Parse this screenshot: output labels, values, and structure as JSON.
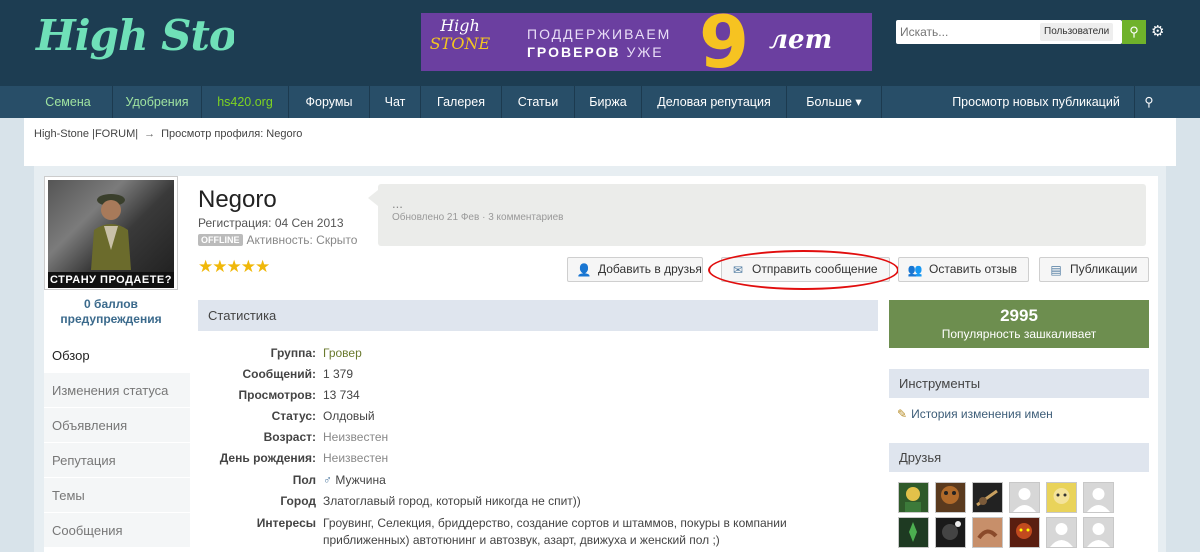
{
  "header": {
    "logo_text": "High Stone",
    "banner": {
      "logo_line1": "High",
      "logo_line2": "STONE",
      "text_line1": "ПОДДЕРЖИВАЕМ",
      "text_line2a": "ГРОВЕРОВ",
      "text_line2b": "УЖЕ",
      "number": "9",
      "years": "лет"
    },
    "search": {
      "placeholder": "Искать...",
      "scope": "Пользователи"
    }
  },
  "nav": {
    "items": [
      "Семена",
      "Удобрения",
      "hs420.org",
      "Форумы",
      "Чат",
      "Галерея",
      "Статьи",
      "Биржа",
      "Деловая репутация",
      "Больше ▾"
    ],
    "right": "Просмотр новых публикаций"
  },
  "breadcrumb": {
    "home": "High-Stone |FORUM|",
    "arrow": "→",
    "current": "Просмотр профиля: Negoro"
  },
  "profile": {
    "avatar_caption": "СТРАНУ ПРОДАЕТЕ?",
    "warn_line1": "0 баллов",
    "warn_line2": "предупреждения",
    "name": "Negoro",
    "registration": "Регистрация: 04 Сен 2013",
    "offline": "OFFLINE",
    "activity": "Активность: Скрыто",
    "stars": "★★★★★",
    "status_text": "...",
    "status_meta": "Обновлено 21 Фев · 3 комментариев"
  },
  "side_nav": [
    "Обзор",
    "Изменения статуса",
    "Объявления",
    "Репутация",
    "Темы",
    "Сообщения"
  ],
  "buttons": {
    "add_friend": "Добавить в друзья",
    "send_message": "Отправить сообщение",
    "leave_review": "Оставить отзыв",
    "publications": "Публикации"
  },
  "stats": {
    "title": "Статистика",
    "rows": [
      {
        "label": "Группа:",
        "value": "Гровер"
      },
      {
        "label": "Сообщений:",
        "value": "1 379"
      },
      {
        "label": "Просмотров:",
        "value": "13 734"
      },
      {
        "label": "Статус:",
        "value": "Олдовый"
      },
      {
        "label": "Возраст:",
        "value": "Неизвестен"
      },
      {
        "label": "День рождения:",
        "value": "Неизвестен"
      },
      {
        "label": "Пол",
        "value": "Мужчина"
      },
      {
        "label": "Город",
        "value": "Златоглавый город, который никогда не спит))"
      },
      {
        "label": "Интересы",
        "value": "Гроувинг, Селекция, бриддерство, создание сортов и штаммов, покуры в компании приближенных) автотюнинг и автозвук, азарт, движуха и женский пол ;)"
      }
    ]
  },
  "right": {
    "popularity_value": "2995",
    "popularity_label": "Популярность зашкаливает",
    "tools_title": "Инструменты",
    "tool_link": "История изменения имен",
    "friends_title": "Друзья"
  },
  "colors": {
    "accent_green": "#6d8e4f",
    "nav_bg": "#284e68",
    "header_bg": "#1d3d52",
    "highlight_oval": "#e10d0d"
  }
}
